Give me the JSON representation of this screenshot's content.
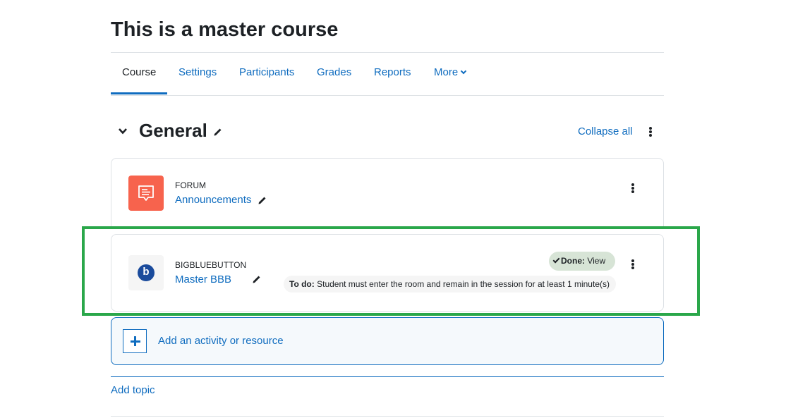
{
  "page": {
    "title": "This is a master course"
  },
  "nav": {
    "tabs": [
      {
        "label": "Course",
        "active": true
      },
      {
        "label": "Settings"
      },
      {
        "label": "Participants"
      },
      {
        "label": "Grades"
      },
      {
        "label": "Reports"
      },
      {
        "label": "More"
      }
    ]
  },
  "section": {
    "title": "General",
    "collapse_label": "Collapse all"
  },
  "activities": [
    {
      "type": "FORUM",
      "name": "Announcements",
      "icon": "forum-icon"
    },
    {
      "type": "BIGBLUEBUTTON",
      "name": "Master BBB",
      "icon": "bigbluebutton-icon",
      "icon_letter": "b",
      "done_label": "Done:",
      "done_value": "View",
      "todo_label": "To do:",
      "todo_text": "Student must enter the room and remain in the session for at least 1 minute(s)"
    }
  ],
  "add_activity": {
    "label": "Add an activity or resource"
  },
  "add_topic": {
    "label": "Add topic"
  },
  "colors": {
    "link": "#0f6cbf",
    "forum": "#f7634d",
    "highlight": "#2aa74a",
    "done_bg": "#d7e4d6"
  }
}
